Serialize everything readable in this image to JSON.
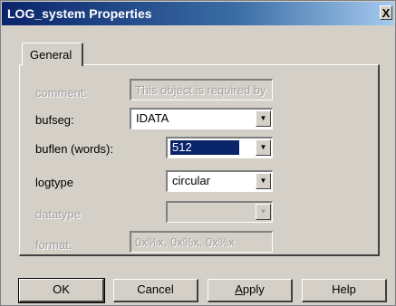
{
  "window": {
    "title": "LOG_system Properties",
    "close_glyph": "X"
  },
  "tabs": [
    {
      "label": "General"
    }
  ],
  "form": {
    "comment": {
      "label": "comment:",
      "value": "This object is required by",
      "enabled": false
    },
    "bufseg": {
      "label": "bufseg:",
      "value": "IDATA",
      "enabled": true
    },
    "buflen": {
      "label": "buflen (words):",
      "value": "512",
      "enabled": true,
      "selected": true
    },
    "logtype": {
      "label": "logtype",
      "value": "circular",
      "enabled": true
    },
    "datatype": {
      "label": "datatype",
      "value": "",
      "enabled": false
    },
    "format": {
      "label": "format:",
      "value": "0x%x, 0x%x, 0x%x",
      "enabled": false
    }
  },
  "buttons": {
    "ok": "OK",
    "cancel": "Cancel",
    "apply_prefix": "",
    "apply_mnemonic": "A",
    "apply_rest": "pply",
    "help": "Help"
  },
  "colors": {
    "title_bar": "#0a246a",
    "selection": "#0a246a",
    "face": "#d4d0c8"
  }
}
